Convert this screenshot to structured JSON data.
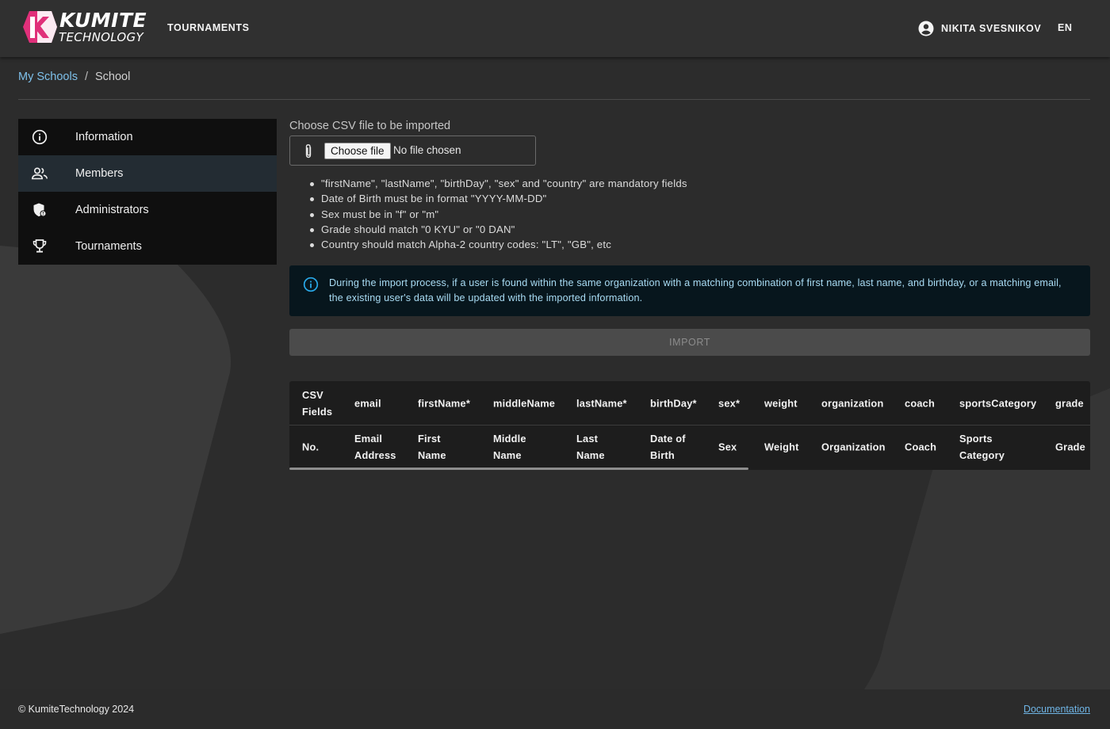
{
  "header": {
    "logo_main": "KUMITE",
    "logo_sub": "TECHNOLOGY",
    "nav_tournaments": "TOURNAMENTS",
    "user_name": "NIKITA SVESNIKOV",
    "language": "EN"
  },
  "breadcrumb": {
    "parent": "My Schools",
    "separator": "/",
    "current": "School"
  },
  "sidebar": {
    "items": [
      {
        "label": "Information",
        "icon": "info-icon",
        "active": false
      },
      {
        "label": "Members",
        "icon": "people-icon",
        "active": true
      },
      {
        "label": "Administrators",
        "icon": "shield-admin-icon",
        "active": false
      },
      {
        "label": "Tournaments",
        "icon": "trophy-icon",
        "active": false
      }
    ]
  },
  "import": {
    "file_label": "Choose CSV file to be imported",
    "choose_button": "Choose file",
    "file_status": "No file chosen",
    "rules": [
      "\"firstName\", \"lastName\", \"birthDay\", \"sex\" and \"country\" are mandatory fields",
      "Date of Birth must be in format \"YYYY-MM-DD\"",
      "Sex must be in \"f\" or \"m\"",
      "Grade should match \"0 KYU\" or \"0 DAN\"",
      "Country should match Alpha-2 country codes: \"LT\", \"GB\", etc"
    ],
    "info_text": "During the import process, if a user is found within the same organization with a matching combination of first name, last name, and birthday, or a matching email, the existing user's data will be updated with the imported information.",
    "import_button": "IMPORT"
  },
  "mapping_table": {
    "csv_fields": [
      "CSV Fields",
      "email",
      "firstName*",
      "middleName",
      "lastName*",
      "birthDay*",
      "sex*",
      "weight",
      "organization",
      "coach",
      "sportsCategory",
      "grade"
    ],
    "labels": [
      "No.",
      "Email Address",
      "First Name",
      "Middle Name",
      "Last Name",
      "Date of Birth",
      "Sex",
      "Weight",
      "Organization",
      "Coach",
      "Sports Category",
      "Grade"
    ]
  },
  "footer": {
    "copyright": "© KumiteTechnology 2024",
    "documentation": "Documentation"
  },
  "colors": {
    "accent_link": "#7ec0ea",
    "active_menu": "#232c33",
    "info_bg": "#07161d",
    "info_text": "#a9dcf4",
    "logo_pink": "#e0307a"
  }
}
